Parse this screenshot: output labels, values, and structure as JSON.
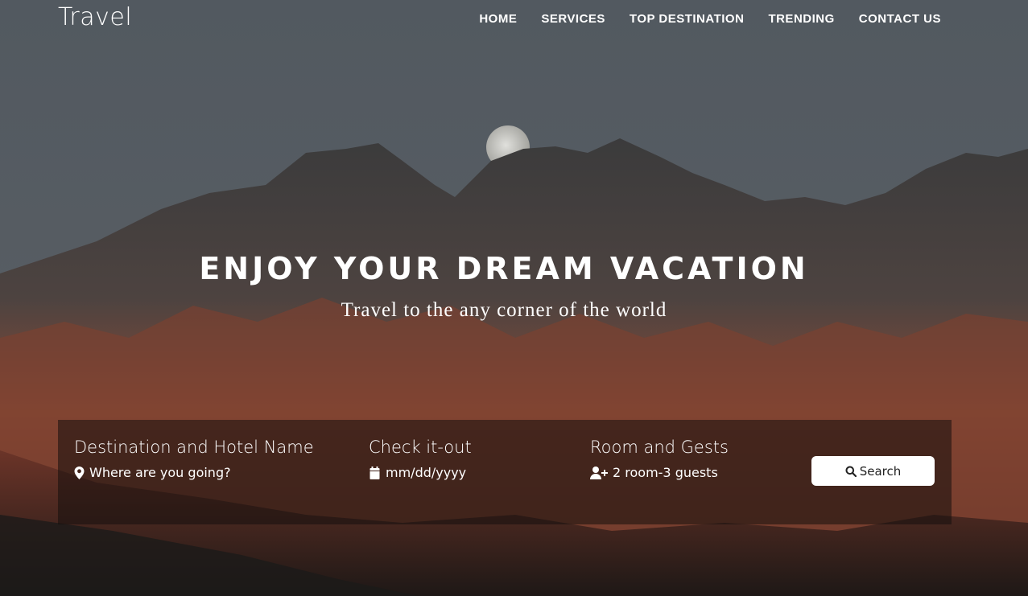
{
  "header": {
    "logo": "Travel",
    "nav": [
      {
        "label": "HOME"
      },
      {
        "label": "SERVICES"
      },
      {
        "label": "TOP DESTINATION"
      },
      {
        "label": "TRENDING"
      },
      {
        "label": "CONTACT US"
      }
    ]
  },
  "hero": {
    "title": "ENJOY YOUR DREAM VACATION",
    "subtitle": "Travel to the any corner of the world"
  },
  "search": {
    "destination": {
      "label": "Destination and Hotel Name",
      "placeholder": "Where are you going?",
      "icon": "map-marker-icon"
    },
    "checkout": {
      "label": "Check it-out",
      "placeholder": "mm/dd/yyyy",
      "icon": "calendar-icon"
    },
    "rooms": {
      "label": "Room and Gests",
      "value": "2 room-3 guests",
      "icon": "user-plus-icon"
    },
    "button_label": "Search",
    "button_icon": "search-icon"
  },
  "colors": {
    "sky": "#525860",
    "mountain_dark": "#3c3c3c",
    "mountain_red": "#7a4232",
    "panel": "#140e0c",
    "button_bg": "#ffffff"
  }
}
